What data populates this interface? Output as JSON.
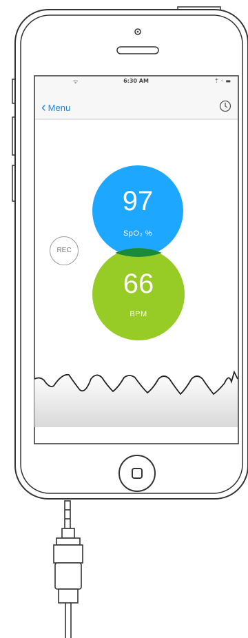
{
  "status_bar": {
    "signal": "ᯤ",
    "time": "6:30 AM",
    "right": "⇡ ◦ ▬"
  },
  "nav": {
    "back_label": "Menu",
    "history_icon": "history-icon"
  },
  "readings": {
    "spo2_value": "97",
    "spo2_label": "SpO₂ %",
    "bpm_value": "66",
    "bpm_label": "BPM"
  },
  "record_button": {
    "label": "REC"
  },
  "colors": {
    "spo2": "#1ea7ff",
    "bpm": "#97cb25",
    "overlap": "#1a8a3a",
    "accent": "#1e88e5"
  }
}
